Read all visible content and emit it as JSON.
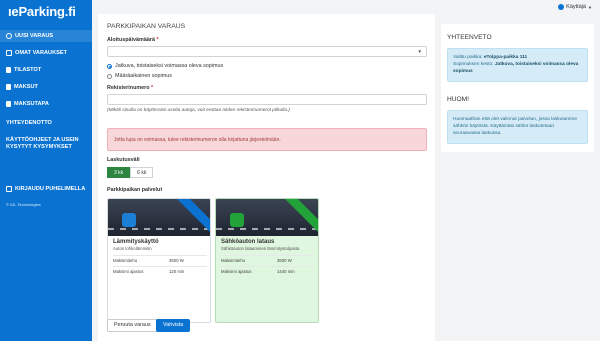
{
  "sidebar": {
    "logo": "ıeParking.fi",
    "items": [
      {
        "label": "UUSI VARAUS",
        "icon": "plus-circle-icon"
      },
      {
        "label": "OMAT VARAUKSET",
        "icon": "list-icon"
      },
      {
        "label": "TILASTOT",
        "icon": "chart-icon"
      },
      {
        "label": "MAKSUT",
        "icon": "wallet-icon"
      },
      {
        "label": "MAKSUTAPA",
        "icon": "card-icon"
      }
    ],
    "contact": "YHTEYDENOTTO",
    "faq_line1": "KÄYTTÖOHJEET JA USEIN",
    "faq_line2": "KYSYTYT KYSYMYKSET",
    "phone_login": "KIRJAUDU PUHELIMELLA",
    "copyright": "© IGL Technologies"
  },
  "user_menu": {
    "label": "Käyttäjä"
  },
  "form": {
    "title": "PARKKIPAIKAN VARAUS",
    "start_date_label": "Aloituspäivämäärä",
    "required_mark": "*",
    "start_date_value": "",
    "radio_continuous": "Jatkuva, toistaiseksi voimassa oleva sopimus",
    "radio_fixed": "Määräaikainen sopimus",
    "reg_label": "Rekisterinumero",
    "reg_value": "",
    "reg_help": "(Mikäli sinulla on käytössäsi useita autoja, voit erottaa niiden rekisterinumerot pilkulla.)",
    "alert": "Jotta lupa on voimassa, tulee rekisterinumeron olla kirjattuna järjestelmään.",
    "billing_label": "Laskutusväli",
    "billing_options": [
      "3 kk",
      "6 kk"
    ],
    "services_label": "Parkkipaikan palvelut"
  },
  "services": [
    {
      "name": "Lämmityskäyttö",
      "desc": "Auton lohkolämmitin",
      "rows": [
        {
          "k": "Maksimiteho",
          "v": "3600 W"
        },
        {
          "k": "Maksimi ajastus",
          "v": "120 min"
        }
      ],
      "selected": false
    },
    {
      "name": "Sähköauton lataus",
      "desc": "Sähköauton lataaminen lämmitystolpasta",
      "rows": [
        {
          "k": "Maksimiteho",
          "v": "3600 W"
        },
        {
          "k": "Maksimi ajastus",
          "v": "1440 min"
        }
      ],
      "selected": true
    }
  ],
  "buttons": {
    "cancel": "Peruuta varaus",
    "confirm": "Vahvista"
  },
  "summary": {
    "title": "YHTEENVETO",
    "spot_label": "Valittu paikka:",
    "spot_value": "eTolppa-paikka 111",
    "contract_label": "Sopimuksen kesto:",
    "contract_value": "Jatkuva, toistaiseksi voimassa oleva sopimus"
  },
  "notice": {
    "title": "HUOM!",
    "text": "Huomaathan että olet valinnut palvelun, jossa laskutamme sähkön käytöstä. Käyttämäsi sähkö laskutetaan seuraavassa laskussa."
  },
  "colors": {
    "sidebar": "#0a73d1",
    "primary": "#0a73d1",
    "success": "#2e8540",
    "alert_bg": "#f8d7da",
    "info_bg": "#d5ebf7"
  }
}
